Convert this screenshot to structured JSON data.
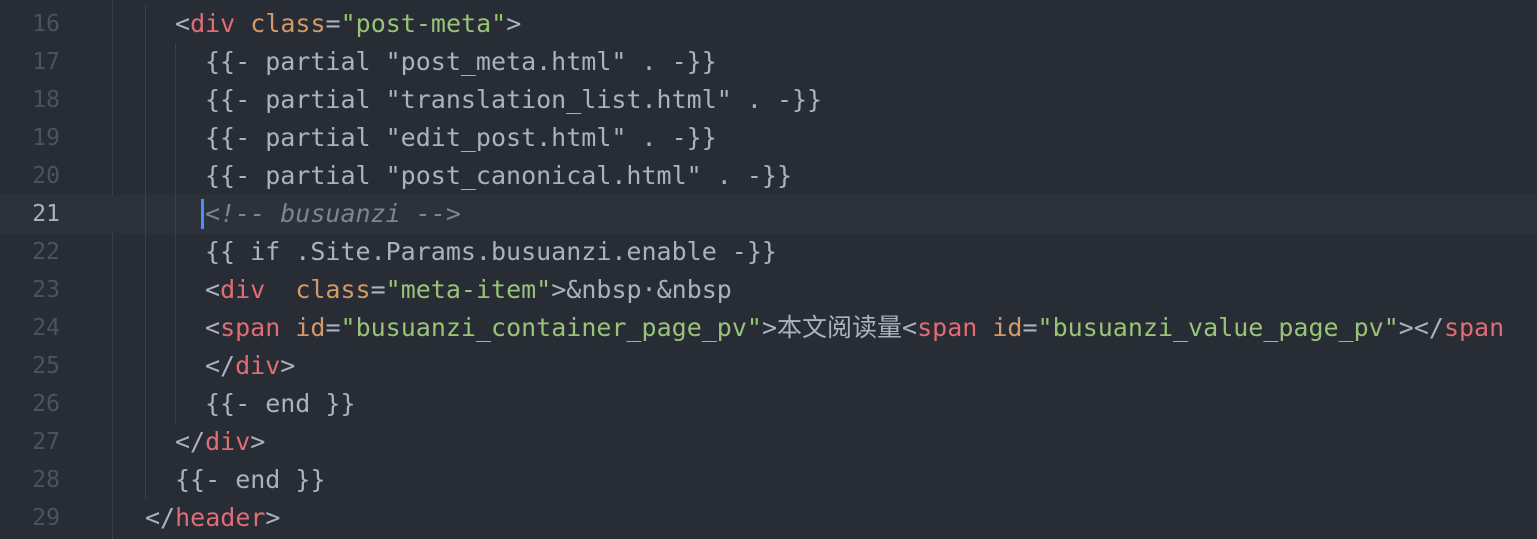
{
  "editor": {
    "theme_colors": {
      "background": "#282c34",
      "active_line": "#2c313a",
      "line_number": "#4b5263",
      "text": "#abb2bf",
      "tag": "#e06c75",
      "attribute": "#d19a66",
      "string": "#98c379",
      "comment": "#7f848e",
      "cursor": "#528bff"
    },
    "active_line_number": "21",
    "lines": [
      {
        "n": "16",
        "tokens": [
          [
            "t-punc",
            "<"
          ],
          [
            "t-tag",
            "div"
          ],
          [
            "t-txt",
            " "
          ],
          [
            "t-attr",
            "class"
          ],
          [
            "t-punc",
            "="
          ],
          [
            "t-str",
            "\"post-meta\""
          ],
          [
            "t-punc",
            ">"
          ]
        ]
      },
      {
        "n": "17",
        "tokens": [
          [
            "t-txt",
            "{{- partial \"post_meta.html\" . -}}"
          ]
        ]
      },
      {
        "n": "18",
        "tokens": [
          [
            "t-txt",
            "{{- partial \"translation_list.html\" . -}}"
          ]
        ]
      },
      {
        "n": "19",
        "tokens": [
          [
            "t-txt",
            "{{- partial \"edit_post.html\" . -}}"
          ]
        ]
      },
      {
        "n": "20",
        "tokens": [
          [
            "t-txt",
            "{{- partial \"post_canonical.html\" . -}}"
          ]
        ]
      },
      {
        "n": "21",
        "tokens": [
          [
            "t-cmt",
            "<!-- busuanzi -->"
          ]
        ]
      },
      {
        "n": "22",
        "tokens": [
          [
            "t-txt",
            "{{ if .Site.Params.busuanzi.enable -}}"
          ]
        ]
      },
      {
        "n": "23",
        "tokens": [
          [
            "t-punc",
            "<"
          ],
          [
            "t-tag",
            "div"
          ],
          [
            "t-txt",
            "  "
          ],
          [
            "t-attr",
            "class"
          ],
          [
            "t-punc",
            "="
          ],
          [
            "t-str",
            "\"meta-item\""
          ],
          [
            "t-punc",
            ">"
          ],
          [
            "t-txt",
            "&nbsp·&nbsp"
          ]
        ]
      },
      {
        "n": "24",
        "tokens": [
          [
            "t-punc",
            "<"
          ],
          [
            "t-tag",
            "span"
          ],
          [
            "t-txt",
            " "
          ],
          [
            "t-attr",
            "id"
          ],
          [
            "t-punc",
            "="
          ],
          [
            "t-str",
            "\"busuanzi_container_page_pv\""
          ],
          [
            "t-punc",
            ">"
          ],
          [
            "t-cjk",
            "本文阅读量"
          ],
          [
            "t-punc",
            "<"
          ],
          [
            "t-tag",
            "span"
          ],
          [
            "t-txt",
            " "
          ],
          [
            "t-attr",
            "id"
          ],
          [
            "t-punc",
            "="
          ],
          [
            "t-str",
            "\"busuanzi_value_page_pv\""
          ],
          [
            "t-punc",
            "></"
          ],
          [
            "t-tag",
            "span"
          ]
        ]
      },
      {
        "n": "25",
        "tokens": [
          [
            "t-punc",
            "</"
          ],
          [
            "t-tag",
            "div"
          ],
          [
            "t-punc",
            ">"
          ]
        ]
      },
      {
        "n": "26",
        "tokens": [
          [
            "t-txt",
            "{{- end }}"
          ]
        ]
      },
      {
        "n": "27",
        "tokens": [
          [
            "t-punc",
            "</"
          ],
          [
            "t-tag",
            "div"
          ],
          [
            "t-punc",
            ">"
          ]
        ]
      },
      {
        "n": "28",
        "tokens": [
          [
            "t-txt",
            "{{- end }}"
          ]
        ]
      },
      {
        "n": "29",
        "tokens": [
          [
            "t-punc",
            "</"
          ],
          [
            "t-tag",
            "header"
          ],
          [
            "t-punc",
            ">"
          ]
        ]
      }
    ]
  }
}
